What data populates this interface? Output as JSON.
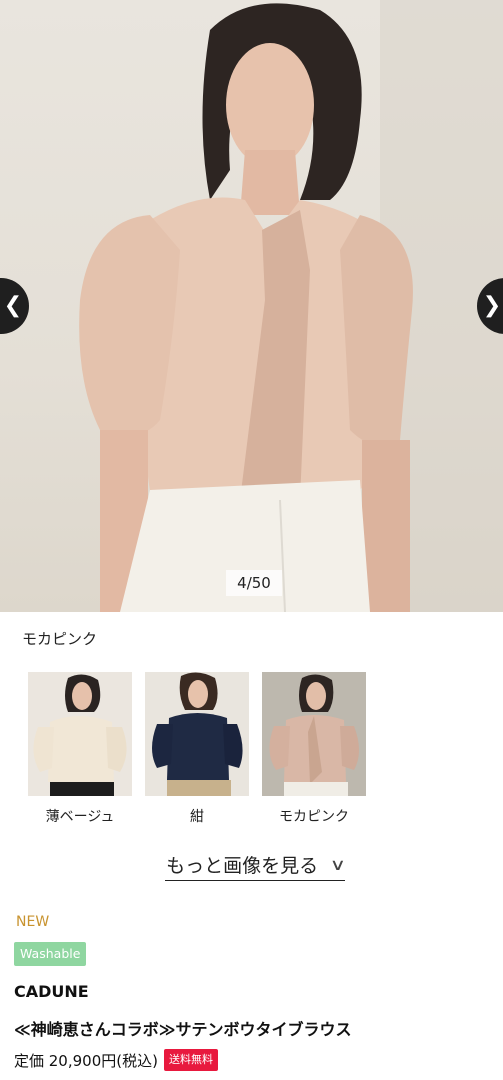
{
  "gallery": {
    "counter": "4/50",
    "prev_icon": "chevron-left-icon",
    "next_icon": "chevron-right-icon",
    "selected_color": "モカピンク"
  },
  "swatches": [
    {
      "label": "薄ベージュ",
      "color": "#efe6d6"
    },
    {
      "label": "紺",
      "color": "#1f2a44"
    },
    {
      "label": "モカピンク",
      "color": "#d9b7a6"
    }
  ],
  "more_images": {
    "label": "もっと画像を見る",
    "icon": "chevron-down-icon"
  },
  "product": {
    "new_label": "NEW",
    "tag": "Washable",
    "brand": "CADUNE",
    "name": "≪神崎恵さんコラボ≫サテンボウタイブラウス",
    "price": "定価 20,900円(税込)",
    "shipping_badge": "送料無料"
  },
  "colors": {
    "accent_new": "#c8932f",
    "washable_bg": "#8fd6a0",
    "shipping_bg": "#e8193e"
  }
}
